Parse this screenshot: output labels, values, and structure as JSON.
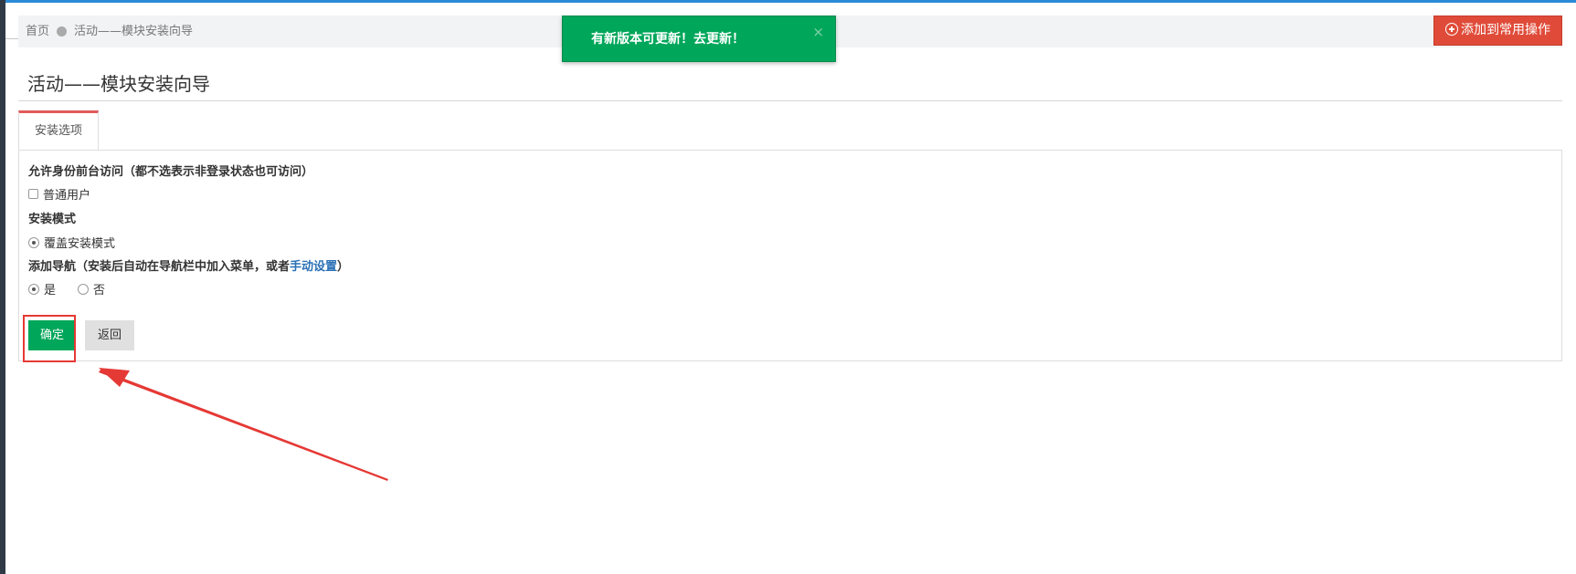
{
  "breadcrumb": {
    "home": "首页",
    "current": "活动——模块安装向导"
  },
  "toolbar": {
    "add_favorite": "添加到常用操作"
  },
  "toast": {
    "message": "有新版本可更新！",
    "link": "去更新！",
    "close": "×"
  },
  "page": {
    "title": "活动——模块安装向导"
  },
  "tabs": [
    {
      "label": "安装选项",
      "active": true
    }
  ],
  "form": {
    "access": {
      "label": "允许身份前台访问（都不选表示非登录状态也可访问）",
      "options": [
        {
          "label": "普通用户",
          "checked": false
        }
      ]
    },
    "mode": {
      "label": "安装模式",
      "options": [
        {
          "label": "覆盖安装模式",
          "checked": true
        }
      ]
    },
    "nav": {
      "label_prefix": "添加导航（安装后自动在导航栏中加入菜单，或者",
      "label_link": "手动设置",
      "label_suffix": "）",
      "options": [
        {
          "label": "是",
          "checked": true
        },
        {
          "label": "否",
          "checked": false
        }
      ]
    },
    "buttons": {
      "confirm": "确定",
      "back": "返回"
    }
  },
  "colors": {
    "accent_green": "#00a65a",
    "danger_red": "#e04b39",
    "annotation_red": "#e53935",
    "link_blue": "#2a6fb5"
  }
}
